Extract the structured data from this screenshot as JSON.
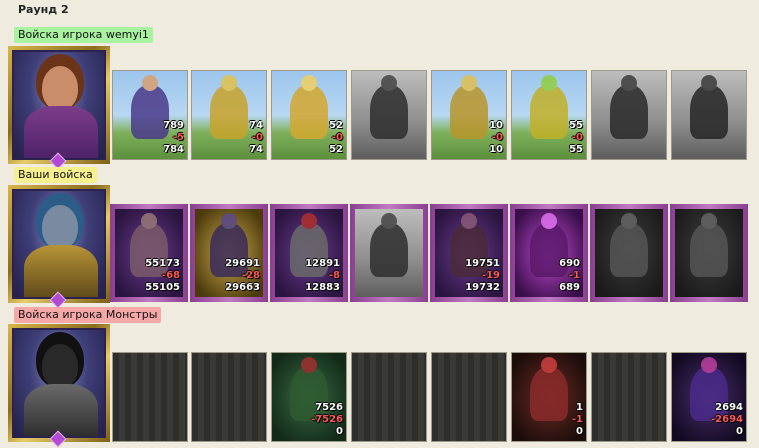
{
  "round_title": "Раунд 2",
  "rows": [
    {
      "label": "Войска игрока wemyi1",
      "label_color": "#a8f2a0",
      "portrait_icon": "female-hero-portrait",
      "units": [
        {
          "icon": "dwarf-riding-donkey-icon",
          "count": "789",
          "loss": "-5",
          "remaining": "784"
        },
        {
          "icon": "golden-knight-icon",
          "count": "74",
          "loss": "-0",
          "remaining": "74"
        },
        {
          "icon": "golden-cavalier-icon",
          "count": "52",
          "loss": "-0",
          "remaining": "52"
        },
        {
          "icon": "gray-pegasus-icon",
          "count": "",
          "loss": "",
          "remaining": ""
        },
        {
          "icon": "crossbowman-icon",
          "count": "10",
          "loss": "-0",
          "remaining": "10"
        },
        {
          "icon": "monk-icon",
          "count": "55",
          "loss": "-0",
          "remaining": "55"
        },
        {
          "icon": "gray-warrior-icon",
          "count": "",
          "loss": "",
          "remaining": ""
        },
        {
          "icon": "gray-reaper-icon",
          "count": "",
          "loss": "",
          "remaining": ""
        }
      ]
    },
    {
      "label": "Ваши войска",
      "label_color": "#f6f18e",
      "portrait_icon": "dark-elf-hero-portrait",
      "units": [
        {
          "icon": "troglodyte-icon",
          "count": "55173",
          "loss": "-68",
          "remaining": "55105"
        },
        {
          "icon": "dark-assassin-icon",
          "count": "29691",
          "loss": "-28",
          "remaining": "29663"
        },
        {
          "icon": "dragon-rider-icon",
          "count": "12891",
          "loss": "-8",
          "remaining": "12883"
        },
        {
          "icon": "gray-harpy-icon",
          "count": "",
          "loss": "",
          "remaining": ""
        },
        {
          "icon": "dark-archer-icon",
          "count": "19751",
          "loss": "-19",
          "remaining": "19732"
        },
        {
          "icon": "witch-icon",
          "count": "690",
          "loss": "-1",
          "remaining": "689"
        },
        {
          "icon": "gray-hooded-icon",
          "count": "",
          "loss": "",
          "remaining": ""
        },
        {
          "icon": "gray-spider-icon",
          "count": "",
          "loss": "",
          "remaining": ""
        }
      ]
    },
    {
      "label": "Войска игрока Монстры",
      "label_color": "#f6a7a7",
      "portrait_icon": "beast-knight-portrait",
      "units": [
        {
          "icon": "empty-slot-icon",
          "count": "",
          "loss": "",
          "remaining": ""
        },
        {
          "icon": "empty-slot-icon",
          "count": "",
          "loss": "",
          "remaining": ""
        },
        {
          "icon": "orc-warlord-icon",
          "count": "7526",
          "loss": "-7526",
          "remaining": "0"
        },
        {
          "icon": "empty-slot-icon",
          "count": "",
          "loss": "",
          "remaining": ""
        },
        {
          "icon": "empty-slot-icon",
          "count": "",
          "loss": "",
          "remaining": ""
        },
        {
          "icon": "fire-imp-icon",
          "count": "1",
          "loss": "-1",
          "remaining": "0"
        },
        {
          "icon": "empty-slot-icon",
          "count": "",
          "loss": "",
          "remaining": ""
        },
        {
          "icon": "demon-lord-icon",
          "count": "2694",
          "loss": "-2694",
          "remaining": "0"
        }
      ]
    }
  ]
}
